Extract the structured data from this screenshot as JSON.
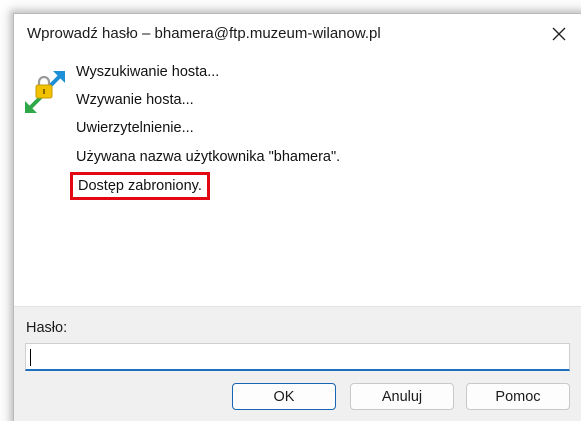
{
  "window": {
    "title": "Wprowadź hasło – bhamera@ftp.muzeum-wilanow.pl",
    "close_icon": "close-icon"
  },
  "log": {
    "icon": "connection-lock-icon",
    "lines": [
      "Wyszukiwanie hosta...",
      "Wzywanie hosta...",
      "Uwierzytelnienie...",
      "Używana nazwa użytkownika \"bhamera\".",
      "Dostęp zabroniony."
    ],
    "highlight_color": "#e30613"
  },
  "password": {
    "label": "Hasło:",
    "value": ""
  },
  "buttons": {
    "ok": "OK",
    "cancel": "Anuluj",
    "help": "Pomoc"
  },
  "colors": {
    "accent": "#1a64b4"
  }
}
